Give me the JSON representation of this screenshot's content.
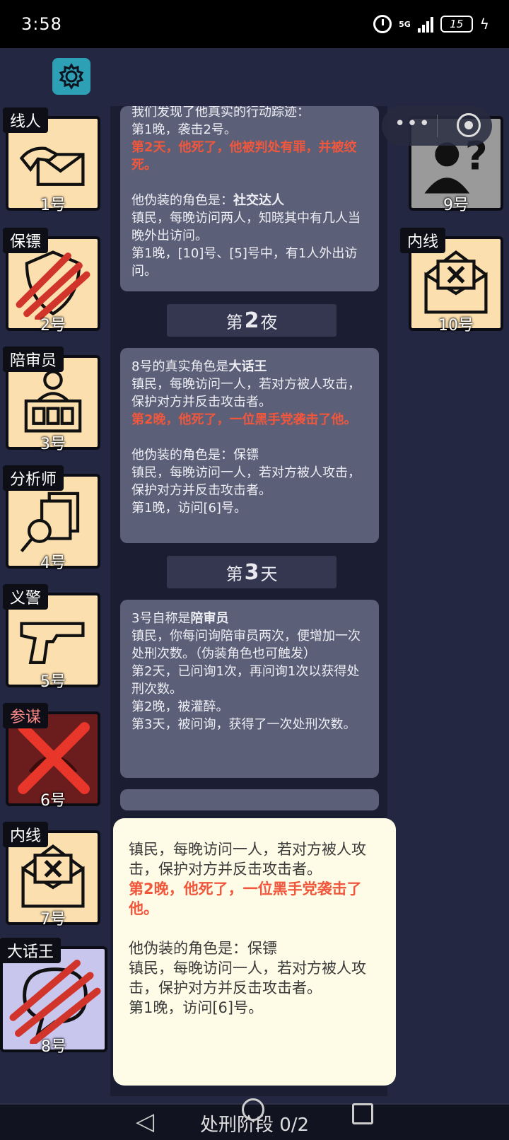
{
  "status_bar": {
    "time": "3:58",
    "network": "5G",
    "battery": "15"
  },
  "card_top": {
    "line1": "我们发现了他真实的行动踪迹：",
    "line2": "第1晚，袭击2号。",
    "red": "第2天，他死了，他被判处有罪，并被绞死。",
    "disguise_prefix": "他伪装的角色是：",
    "disguise_role": "社交达人",
    "desc": "镇民，每晚访问两人，知晓其中有几人当晚外出访问。",
    "night": "第1晚，[10]号、[5]号中，有1人外出访问。"
  },
  "divider_night2": {
    "prefix": "第",
    "num": "2",
    "suffix": "夜"
  },
  "card_mid": {
    "true_prefix": "8号的真实角色是",
    "true_role": "大话王",
    "desc": "镇民，每晚访问一人，若对方被人攻击，保护对方并反击攻击者。",
    "red": "第2晚，他死了，一位黑手党袭击了他。",
    "disguise": "他伪装的角色是：保镖",
    "desc2": "镇民，每晚访问一人，若对方被人攻击，保护对方并反击攻击者。",
    "night": "第1晚，访问[6]号。"
  },
  "divider_day3": {
    "prefix": "第",
    "num": "3",
    "suffix": "天"
  },
  "card_bottom": {
    "claim_prefix": "3号自称是",
    "claim_role": "陪审员",
    "desc": "镇民，你每问询陪审员两次，便增加一次处刑次数。（伪装角色也可触发）",
    "l1": "第2天，已问询1次，再问询1次以获得处刑次数。",
    "l2": "第2晚，被灌醉。",
    "l3": "第3天，被问询，获得了一次处刑次数。"
  },
  "popup": {
    "desc": "镇民，每晚访问一人，若对方被人攻击，保护对方并反击攻击者。",
    "red": "第2晚，他死了，一位黑手党袭击了他。",
    "disguise": "他伪装的角色是：保镖",
    "desc2": "镇民，每晚访问一人，若对方被人攻击，保护对方并反击攻击者。",
    "night": "第1晚，访问[6]号。"
  },
  "players": [
    {
      "role": "线人",
      "num": "1号",
      "icon": "hand-envelope-icon"
    },
    {
      "role": "保镖",
      "num": "2号",
      "icon": "shield-icon"
    },
    {
      "role": "陪审员",
      "num": "3号",
      "icon": "juror-icon"
    },
    {
      "role": "分析师",
      "num": "4号",
      "icon": "magnifier-docs-icon"
    },
    {
      "role": "义警",
      "num": "5号",
      "icon": "pistol-icon"
    },
    {
      "role": "参谋",
      "num": "6号",
      "icon": "eliminated-icon"
    },
    {
      "role": "内线",
      "num": "7号",
      "icon": "envelope-x-icon"
    },
    {
      "role": "大话王",
      "num": "8号",
      "icon": "speech-bubble-icon"
    },
    {
      "role": "",
      "num": "9号",
      "icon": "unknown-person-icon"
    },
    {
      "role": "内线",
      "num": "10号",
      "icon": "envelope-x-icon"
    }
  ],
  "bottom_bar": {
    "label": "处刑阶段 0/2"
  },
  "colors": {
    "background": "#232741",
    "card": "#5b5f78",
    "highlight_red": "#f0573c",
    "role_card": "#fbdfae",
    "gear": "#2ea0b5"
  }
}
